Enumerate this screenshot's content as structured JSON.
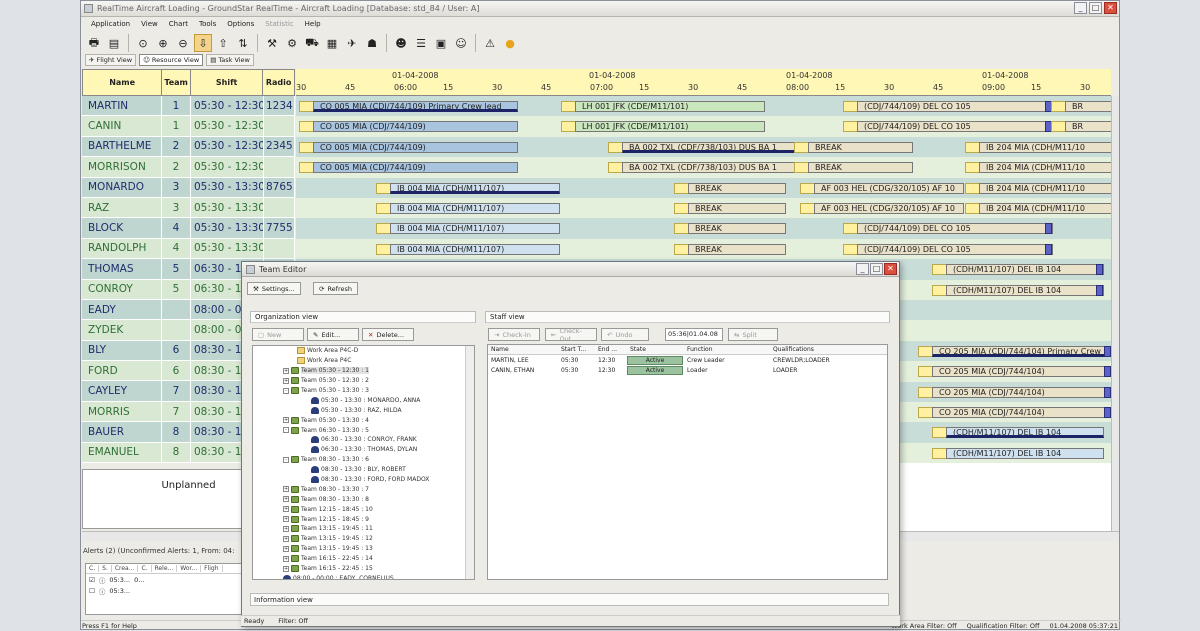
{
  "window": {
    "title": "RealTime Aircraft Loading - GroundStar RealTime - Aircraft Loading  [Database: std_84 / User: A]"
  },
  "menu": [
    "Application",
    "View",
    "Chart",
    "Tools",
    "Options",
    "Statistic",
    "Help"
  ],
  "views": {
    "flight": "Flight View",
    "resource": "Resource View",
    "task": "Task View"
  },
  "resources": {
    "headers": {
      "name": "Name",
      "team": "Team",
      "shift": "Shift",
      "radio": "Radio"
    },
    "rows": [
      {
        "name": "MARTIN",
        "team": "1",
        "shift": "05:30 - 12:30",
        "radio": "1234"
      },
      {
        "name": "CANIN",
        "team": "1",
        "shift": "05:30 - 12:30",
        "radio": ""
      },
      {
        "name": "BARTHELME",
        "team": "2",
        "shift": "05:30 - 12:30",
        "radio": "2345"
      },
      {
        "name": "MORRISON",
        "team": "2",
        "shift": "05:30 - 12:30",
        "radio": ""
      },
      {
        "name": "MONARDO",
        "team": "3",
        "shift": "05:30 - 13:30",
        "radio": "8765"
      },
      {
        "name": "RAZ",
        "team": "3",
        "shift": "05:30 - 13:30",
        "radio": ""
      },
      {
        "name": "BLOCK",
        "team": "4",
        "shift": "05:30 - 13:30",
        "radio": "7755"
      },
      {
        "name": "RANDOLPH",
        "team": "4",
        "shift": "05:30 - 13:30",
        "radio": ""
      },
      {
        "name": "THOMAS",
        "team": "5",
        "shift": "06:30 - 1",
        "radio": ""
      },
      {
        "name": "CONROY",
        "team": "5",
        "shift": "06:30 - 1",
        "radio": ""
      },
      {
        "name": "EADY",
        "team": "",
        "shift": "08:00 - 0",
        "radio": ""
      },
      {
        "name": "ZYDEK",
        "team": "",
        "shift": "08:00 - 0",
        "radio": ""
      },
      {
        "name": "BLY",
        "team": "6",
        "shift": "08:30 - 1",
        "radio": ""
      },
      {
        "name": "FORD",
        "team": "6",
        "shift": "08:30 - 1",
        "radio": ""
      },
      {
        "name": "CAYLEY",
        "team": "7",
        "shift": "08:30 - 1",
        "radio": ""
      },
      {
        "name": "MORRIS",
        "team": "7",
        "shift": "08:30 - 1",
        "radio": ""
      },
      {
        "name": "BAUER",
        "team": "8",
        "shift": "08:30 - 1",
        "radio": ""
      },
      {
        "name": "EMANUEL",
        "team": "8",
        "shift": "08:30 - 1",
        "radio": ""
      }
    ],
    "unplanned": "Unplanned"
  },
  "gantt": {
    "dates": [
      "01-04-2008",
      "01-04-2008",
      "01-04-2008",
      "01-04-2008"
    ],
    "ticks": [
      "30",
      "45",
      "06:00",
      "15",
      "30",
      "45",
      "07:00",
      "15",
      "30",
      "45",
      "08:00",
      "15",
      "30",
      "45",
      "09:00",
      "15",
      "30"
    ],
    "bars": [
      [
        "CO 005 MIA (CDJ/744/109) Primary Crew lead",
        "LH 001 JFK (CDE/M11/101)",
        "(CDJ/744/109) DEL CO 105",
        "BR"
      ],
      [
        "CO 005 MIA (CDJ/744/109)",
        "LH 001 JFK (CDE/M11/101)",
        "(CDJ/744/109) DEL CO 105",
        "BR"
      ],
      [
        "CO 005 MIA (CDJ/744/109)",
        "BA 002 TXL (CDF/738/103) DUS BA 1",
        "BREAK",
        "IB 204 MIA (CDH/M11/10"
      ],
      [
        "CO 005 MIA (CDJ/744/109)",
        "BA 002 TXL (CDF/738/103) DUS BA 1",
        "BREAK",
        "IB 204 MIA (CDH/M11/10"
      ],
      [
        "IB 004 MIA (CDH/M11/107)",
        "BREAK",
        "AF 003 HEL (CDG/320/105) AF 10",
        "IB 204 MIA (CDH/M11/10"
      ],
      [
        "IB 004 MIA (CDH/M11/107)",
        "BREAK",
        "AF 003 HEL (CDG/320/105) AF 10",
        "IB 204 MIA (CDH/M11/10"
      ],
      [
        "IB 004 MIA (CDH/M11/107)",
        "BREAK",
        "(CDJ/744/109) DEL CO 105"
      ],
      [
        "IB 004 MIA (CDH/M11/107)",
        "BREAK",
        "(CDJ/744/109) DEL CO 105"
      ],
      [
        "(CDH/M11/107) DEL IB 104"
      ],
      [
        "(CDH/M11/107) DEL IB 104"
      ],
      [],
      [],
      [
        "CO 205 MIA (CDJ/744/104) Primary Crew l"
      ],
      [
        "CO 205 MIA (CDJ/744/104)"
      ],
      [
        "CO 205 MIA (CDJ/744/104)"
      ],
      [
        "CO 205 MIA (CDJ/744/104)"
      ],
      [
        "(CDH/M11/107) DEL IB 104"
      ],
      [
        "(CDH/M11/107) DEL IB 104"
      ]
    ]
  },
  "alerts": {
    "label": "Alerts (2)    (Unconfirmed Alerts: 1, From: 04:",
    "cols": [
      "C.",
      "S.",
      "Crea...",
      "C.",
      "Rele...",
      "Wor...",
      "Fligh"
    ],
    "rows": [
      {
        "time": "05:3...",
        "extra": "0..."
      },
      {
        "time": "05:3...",
        "extra": ""
      }
    ]
  },
  "status": {
    "help": "Press F1 for Help",
    "wa": "Work Area Filter: Off",
    "qf": "Qualification Filter: Off",
    "dt": "01.04.2008 05:37:21"
  },
  "dialog": {
    "title": "Team Editor",
    "settings": "Settings...",
    "refresh": "Refresh",
    "org_title": "Organization view",
    "new": "New",
    "edit": "Edit...",
    "delete": "Delete...",
    "staff_title": "Staff view",
    "checkin": "Check-In",
    "checkout": "Check-Out",
    "undo": "Undo",
    "time_value": "05:36|01.04.08",
    "split": "Split",
    "tree": [
      {
        "t": "Work Area P4C-D",
        "i": "folder",
        "lvl": 3
      },
      {
        "t": "Work Area P4C",
        "i": "folder",
        "lvl": 3
      },
      {
        "t": "Team 05:30 - 12:30 : 1",
        "i": "team",
        "lvl": 2,
        "ex": "+",
        "sel": true
      },
      {
        "t": "Team 05:30 - 12:30 : 2",
        "i": "team",
        "lvl": 2,
        "ex": "+"
      },
      {
        "t": "Team 05:30 - 13:30 : 3",
        "i": "team",
        "lvl": 2,
        "ex": "-"
      },
      {
        "t": "05:30 - 13:30 : MONARDO, ANNA",
        "i": "person",
        "lvl": 4
      },
      {
        "t": "05:30 - 13:30 : RAZ, HILDA",
        "i": "person",
        "lvl": 4
      },
      {
        "t": "Team 05:30 - 13:30 : 4",
        "i": "team",
        "lvl": 2,
        "ex": "+"
      },
      {
        "t": "Team 06:30 - 13:30 : 5",
        "i": "team",
        "lvl": 2,
        "ex": "-"
      },
      {
        "t": "06:30 - 13:30 : CONROY, FRANK",
        "i": "person",
        "lvl": 4
      },
      {
        "t": "06:30 - 13:30 : THOMAS, DYLAN",
        "i": "person",
        "lvl": 4
      },
      {
        "t": "Team 08:30 - 13:30 : 6",
        "i": "team",
        "lvl": 2,
        "ex": "-"
      },
      {
        "t": "08:30 - 13:30 : BLY, ROBERT",
        "i": "person",
        "lvl": 4
      },
      {
        "t": "08:30 - 13:30 : FORD, FORD MADOX",
        "i": "person",
        "lvl": 4
      },
      {
        "t": "Team 08:30 - 13:30 : 7",
        "i": "team",
        "lvl": 2,
        "ex": "+"
      },
      {
        "t": "Team 08:30 - 13:30 : 8",
        "i": "team",
        "lvl": 2,
        "ex": "+"
      },
      {
        "t": "Team 12:15 - 18:45 : 10",
        "i": "team",
        "lvl": 2,
        "ex": "+"
      },
      {
        "t": "Team 12:15 - 18:45 : 9",
        "i": "team",
        "lvl": 2,
        "ex": "+"
      },
      {
        "t": "Team 13:15 - 19:45 : 11",
        "i": "team",
        "lvl": 2,
        "ex": "+"
      },
      {
        "t": "Team 13:15 - 19:45 : 12",
        "i": "team",
        "lvl": 2,
        "ex": "+"
      },
      {
        "t": "Team 13:15 - 19:45 : 13",
        "i": "team",
        "lvl": 2,
        "ex": "+"
      },
      {
        "t": "Team 16:15 - 22:45 : 14",
        "i": "team",
        "lvl": 2,
        "ex": "+"
      },
      {
        "t": "Team 16:15 - 22:45 : 15",
        "i": "team",
        "lvl": 2,
        "ex": "+"
      },
      {
        "t": "08:00 - 00:00 : EADY, CORNELIUS",
        "i": "person",
        "lvl": 2
      }
    ],
    "staff_cols": [
      "Name",
      "Start T...",
      "End ...",
      "State",
      "Function",
      "Qualifications"
    ],
    "staff_rows": [
      {
        "name": "MARTIN, LEE",
        "start": "05:30",
        "end": "12:30",
        "state": "Active",
        "func": "Crew Leader",
        "qual": "CREWLDR;LOADER"
      },
      {
        "name": "CANIN, ETHAN",
        "start": "05:30",
        "end": "12:30",
        "state": "Active",
        "func": "Loader",
        "qual": "LOADER"
      }
    ],
    "info_title": "Information view",
    "status_ready": "Ready",
    "status_filter": "Filter: Off"
  }
}
